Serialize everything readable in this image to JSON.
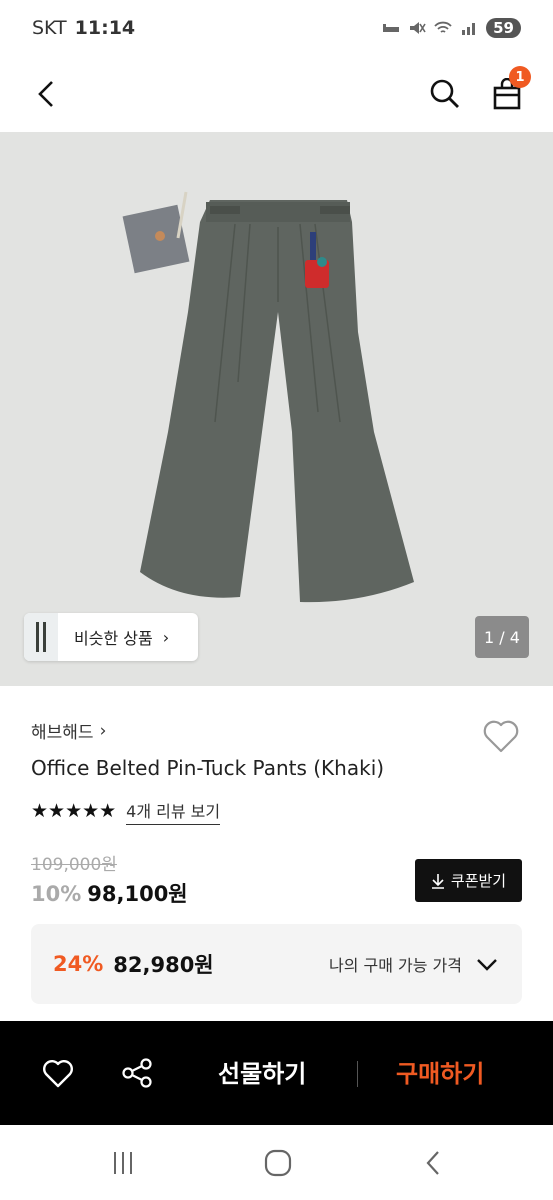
{
  "status": {
    "carrier": "SKT",
    "time": "11:14",
    "battery": "59"
  },
  "header": {
    "cart_count": "1",
    "icons": [
      "back-icon",
      "search-icon",
      "cart-icon"
    ]
  },
  "gallery": {
    "similar_label": "비슷한 상품",
    "similar_chevron": "›",
    "page_indicator": "1 / 4"
  },
  "product": {
    "brand": "해브해드",
    "brand_chevron": "›",
    "name": "Office Belted Pin-Tuck Pants (Khaki)",
    "stars": "★★★★★",
    "review_link": "4개 리뷰 보기",
    "original_price": "109,000원",
    "discount_percent": "10%",
    "discount_price": "98,100원",
    "coupon_label": "쿠폰받기"
  },
  "best_price": {
    "percent": "24%",
    "price": "82,980원",
    "label": "나의 구매 가능 가격"
  },
  "bottom_bar": {
    "gift_label": "선물하기",
    "buy_label": "구매하기"
  },
  "colors": {
    "accent": "#f05a22",
    "black": "#000000",
    "pants": "#5f6560"
  }
}
